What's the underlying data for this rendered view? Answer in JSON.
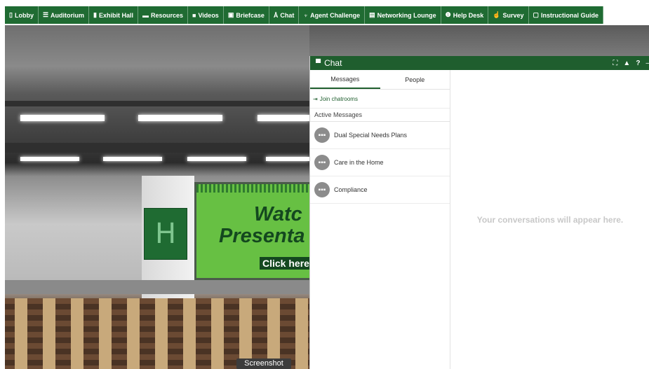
{
  "nav": {
    "items": [
      {
        "label": "Lobby",
        "icon": "building-icon",
        "glyph": "▯"
      },
      {
        "label": "Auditorium",
        "icon": "list-icon",
        "glyph": "☰"
      },
      {
        "label": "Exhibit Hall",
        "icon": "booth-icon",
        "glyph": "▮"
      },
      {
        "label": "Resources",
        "icon": "book-icon",
        "glyph": "▬"
      },
      {
        "label": "Videos",
        "icon": "video-icon",
        "glyph": "■"
      },
      {
        "label": "Briefcase",
        "icon": "briefcase-icon",
        "glyph": "▣"
      },
      {
        "label": "Chat",
        "icon": "person-icon",
        "glyph": "Å"
      },
      {
        "label": "Agent Challenge",
        "icon": "trophy-icon",
        "glyph": "♆"
      },
      {
        "label": "Networking Lounge",
        "icon": "document-icon",
        "glyph": "▤"
      },
      {
        "label": "Help Desk",
        "icon": "info-icon",
        "glyph": "❶"
      },
      {
        "label": "Survey",
        "icon": "thumbs-up-icon",
        "glyph": "☝"
      },
      {
        "label": "Instructional Guide",
        "icon": "file-icon",
        "glyph": "▢"
      }
    ],
    "accent": "#1f6b32"
  },
  "scene": {
    "screen_line1": "Watc",
    "screen_line2": "Presenta",
    "screen_cta": "Click here",
    "logo_letter": "H",
    "screenshot_label": "Screenshot"
  },
  "chat": {
    "title": "Chat",
    "header_icons": [
      "expand-icon",
      "bell-icon",
      "help-icon"
    ],
    "tabs": [
      {
        "label": "Messages",
        "active": true
      },
      {
        "label": "People",
        "active": false
      }
    ],
    "join_label": "Join chatrooms",
    "active_label": "Active Messages",
    "rooms": [
      {
        "name": "Dual Special Needs Plans"
      },
      {
        "name": "Care in the Home"
      },
      {
        "name": "Compliance"
      }
    ],
    "empty_message": "Your conversations will appear here.",
    "header_color": "#1f5e2e"
  }
}
